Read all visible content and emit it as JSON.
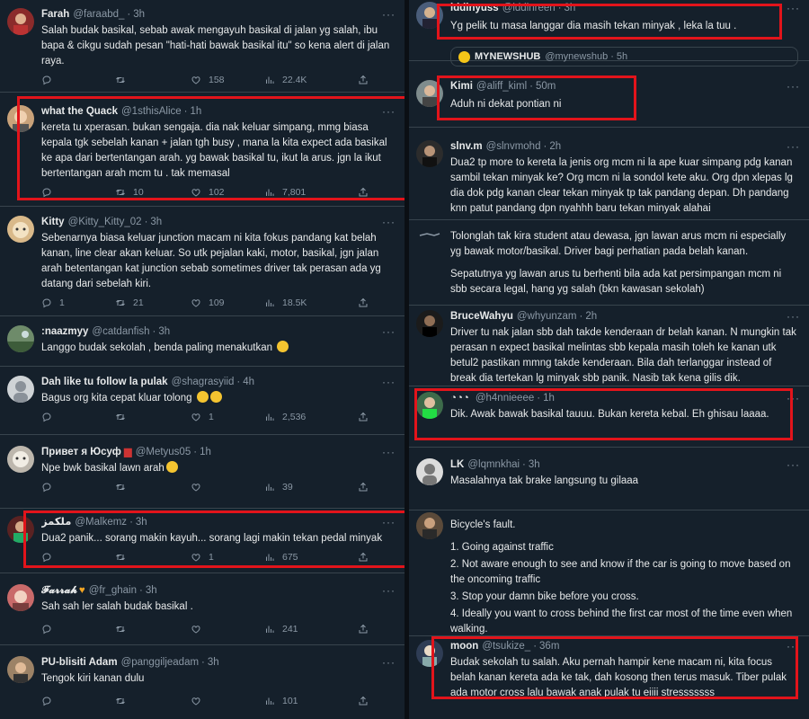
{
  "left_tweets": [
    {
      "name": "Farah",
      "handle": "@faraabd_",
      "time": "3h",
      "text": "Salah budak basikal, sebab awak mengayuh basikal di jalan yg salah, ibu bapa & cikgu sudah pesan \"hati-hati bawak basikal itu\" so kena alert di jalan raya.",
      "retweets": "",
      "likes": "158",
      "views": "22.4K"
    },
    {
      "name": "what the Quack",
      "handle": "@1sthisAlice",
      "time": "1h",
      "text": "kereta tu xperasan. bukan sengaja. dia nak keluar simpang, mmg biasa kepala tgk sebelah kanan + jalan tgh busy , mana la kita expect ada basikal ke apa dari bertentangan arah. yg bawak basikal tu, ikut la arus. jgn la ikut bertentangan arah mcm tu . tak memasal",
      "retweets": "10",
      "likes": "102",
      "views": "7,801"
    },
    {
      "name": "Kitty",
      "handle": "@Kitty_Kitty_02",
      "time": "3h",
      "text": "Sebenarnya biasa keluar junction macam ni kita fokus pandang kat belah kanan, line clear akan keluar. So utk pejalan kaki, motor, basikal, jgn jalan arah betentangan kat junction sebab sometimes driver tak perasan ada yg datang dari sebelah kiri.",
      "replies": "1",
      "retweets": "21",
      "likes": "109",
      "views": "18.5K"
    },
    {
      "name": ":naazmyy",
      "handle": "@catdanfish",
      "time": "3h",
      "text": "Langgo budak sekolah , benda paling menakutkan"
    },
    {
      "name": "Dah like tu follow la pulak",
      "handle": "@shagrasyiid",
      "time": "4h",
      "text": "Bagus org kita cepat kluar tolong",
      "likes": "1",
      "views": "2,536"
    },
    {
      "name": "Привет я Юсуф",
      "handle": "@Metyus05",
      "time": "1h",
      "text": "Npe bwk basikal lawn arah",
      "views": "39"
    },
    {
      "name": "ملكمز",
      "handle": "@Malkemz",
      "time": "3h",
      "text": "Dua2 panik... sorang makin kayuh... sorang lagi makin tekan pedal minyak",
      "likes": "1",
      "views": "675"
    },
    {
      "name": "𝓕𝓪𝓻𝓻𝓪𝓱",
      "handle": "@fr_ghain",
      "time": "3h",
      "text": "Sah sah ler salah budak basikal .",
      "views": "241"
    },
    {
      "name": "PU-blisiti Adam",
      "handle": "@panggiljeadam",
      "time": "3h",
      "text": "Tengok kiri kanan dulu",
      "views": "101"
    }
  ],
  "right_tweets": [
    {
      "name": "iddinyuss",
      "handle": "@iddinreen",
      "time": "3h",
      "text": "Yg pelik tu masa langgar dia masih tekan minyak , leka la tuu ."
    },
    {
      "name": "Kimi",
      "handle": "@aliff_kiml",
      "time": "50m",
      "text": "Aduh ni dekat pontian ni"
    },
    {
      "name": "slnv.m",
      "handle": "@slnvmohd",
      "time": "2h",
      "text": "Dua2 tp more to kereta la jenis org mcm ni la ape kuar simpang pdg kanan sambil tekan minyak ke? Org mcm ni la sondol kete aku. Org dpn xlepas lg dia dok pdg kanan clear tekan minyak tp tak pandang depan. Dh pandang knn patut pandang dpn nyahhh baru tekan minyak alahai"
    },
    {
      "name": "",
      "handle": "",
      "time": "",
      "text": "Tolonglah tak kira student atau dewasa, jgn lawan arus mcm ni especially yg bawak motor/basikal. Driver bagi perhatian pada belah kanan.",
      "text2": "Sepatutnya yg lawan arus tu berhenti bila ada kat persimpangan mcm ni sbb secara legal, hang yg salah (bkn kawasan sekolah)"
    },
    {
      "name": "BruceWahyu",
      "handle": "@whyunzam",
      "time": "2h",
      "text": "Driver tu nak jalan sbb dah takde kenderaan dr belah kanan. N mungkin tak perasan n expect basikal melintas sbb kepala masih toleh ke kanan utk betul2 pastikan mmng takde kenderaan. Bila dah terlanggar instead of break dia tertekan lg minyak sbb panik. Nasib tak kena gilis dik."
    },
    {
      "name": "",
      "handle": "@h4nnieeee",
      "time": "1h",
      "text": "Dik. Awak bawak basikal tauuu. Bukan kereta kebal. Eh ghisau laaaa."
    },
    {
      "name": "LK",
      "handle": "@lqmnkhai",
      "time": "3h",
      "text": "Masalahnya tak brake langsung tu gilaaa"
    },
    {
      "name": "",
      "handle": "",
      "time": "",
      "text": "Bicycle's fault.",
      "list": [
        "1. Going against traffic",
        "2. Not aware enough to see and know if the car is going to move based on the oncoming traffic",
        "3. Stop your damn bike before you cross.",
        "4. Ideally you want to cross behind the first car most of the time even when walking."
      ]
    },
    {
      "name": "moon",
      "handle": "@tsukize_",
      "time": "36m",
      "text": "Budak sekolah tu salah. Aku pernah hampir kene macam ni, kita focus belah kanan kereta ada ke tak, dah kosong then terus masuk. Tiber pulak ada motor cross lalu bawak anak pulak tu eiiii stresssssss"
    }
  ],
  "quote_name": "MYNEWSHUB",
  "quote_handle": "@mynewshub",
  "quote_time": "5h",
  "colors": {
    "bg": "#15202b",
    "text": "#e7e9ea",
    "muted": "#8b98a5",
    "highlight": "#e2141b",
    "border": "#38444d"
  }
}
